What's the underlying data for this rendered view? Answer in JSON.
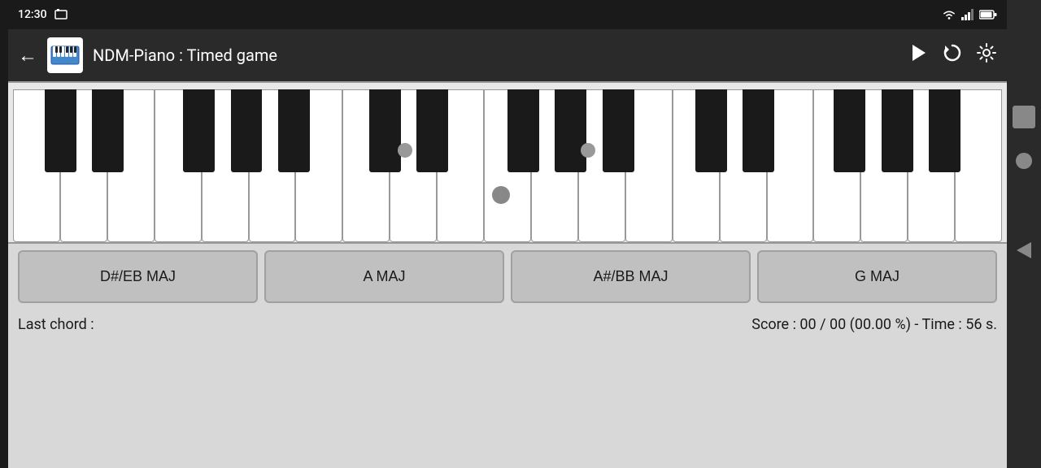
{
  "statusBar": {
    "time": "12:30",
    "wifiIcon": "▼",
    "signalIcon": "◢",
    "batteryIcon": "▮"
  },
  "titleBar": {
    "backLabel": "←",
    "appIconLabel": "🎹",
    "title": "NDM-Piano : Timed game",
    "playIcon": "▶",
    "replayIcon": "↺",
    "settingsIcon": "⚙"
  },
  "chordButtons": [
    {
      "label": "D#/EB MAJ"
    },
    {
      "label": "A MAJ"
    },
    {
      "label": "A#/BB MAJ"
    },
    {
      "label": "G MAJ"
    }
  ],
  "gameStatus": {
    "lastChordLabel": "Last chord :",
    "scoreTimeLabel": "Score :  00 / 00 (00.00 %)  - Time :  56  s."
  }
}
